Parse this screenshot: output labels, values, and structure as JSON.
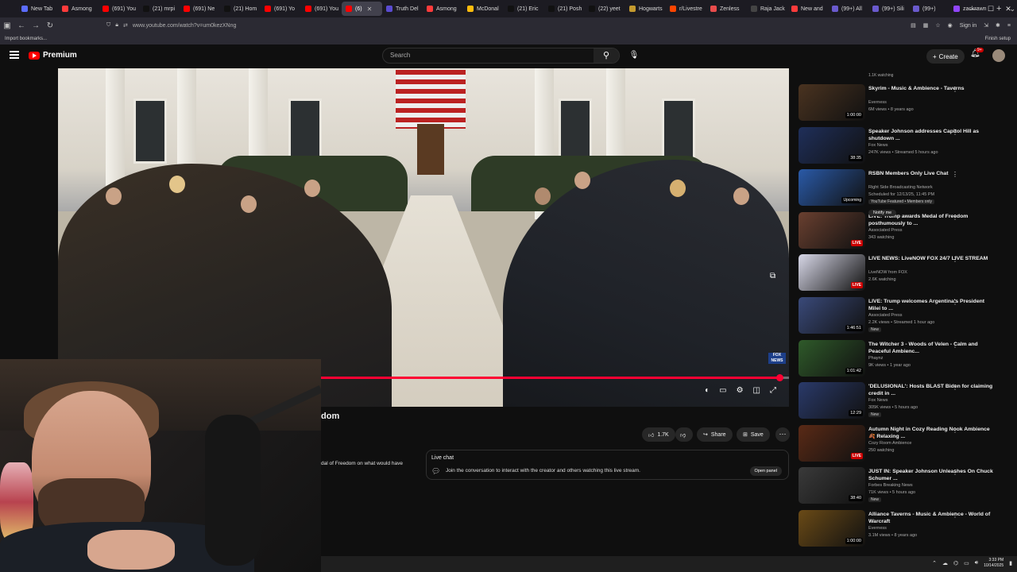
{
  "browser": {
    "tabs": [
      {
        "label": "New Tab",
        "color": "#5b6cff"
      },
      {
        "label": "Asmong",
        "color": "#ff3b3b"
      },
      {
        "label": "(691) You",
        "color": "#ff0000"
      },
      {
        "label": "(21) mrpi",
        "color": "#111111"
      },
      {
        "label": "(691) Ne",
        "color": "#ff0000"
      },
      {
        "label": "(21) Hom",
        "color": "#111111"
      },
      {
        "label": "(691) Yo",
        "color": "#ff0000"
      },
      {
        "label": "(691) You",
        "color": "#ff0000"
      },
      {
        "label": "(6)",
        "color": "#ff0000",
        "active": true
      },
      {
        "label": "Truth Del",
        "color": "#5a4bd1"
      },
      {
        "label": "Asmong",
        "color": "#ff3b3b"
      },
      {
        "label": "McDonal",
        "color": "#ffbc0d"
      },
      {
        "label": "(21) Eric",
        "color": "#111111"
      },
      {
        "label": "(21) Posh",
        "color": "#111111"
      },
      {
        "label": "(22) yeet",
        "color": "#111111"
      },
      {
        "label": "Hogwarts",
        "color": "#c49a2e"
      },
      {
        "label": "r/Livestre",
        "color": "#ff4500"
      },
      {
        "label": "Zenless",
        "color": "#e94c4c"
      },
      {
        "label": "Raja Jack",
        "color": "#444444"
      },
      {
        "label": "New and",
        "color": "#ff3b3b"
      },
      {
        "label": "(99+) All",
        "color": "#6a5acd"
      },
      {
        "label": "(99+) Sili",
        "color": "#6a5acd"
      },
      {
        "label": "(99+)",
        "color": "#6a5acd"
      },
      {
        "label": "zackrawn",
        "color": "#9146ff"
      }
    ],
    "url": "www.youtube.com/watch?v=um0kezXNng",
    "sign_in": "Sign in",
    "bookmarks_left": "Import bookmarks...",
    "bookmarks_right": "Finish setup"
  },
  "youtube": {
    "logo_label": "Premium",
    "search_placeholder": "Search",
    "create_label": "Create",
    "notification_count": "9+"
  },
  "video": {
    "title_partial": "dom",
    "progress_fraction": 0.98,
    "network_bug": "FOX NEWS",
    "likes": "1.7K",
    "share_label": "Share",
    "save_label": "Save",
    "description_partial": "dal of Freedom on what would have"
  },
  "live_chat": {
    "title": "Live chat",
    "message": "Join the conversation to interact with the creator and others watching this live stream.",
    "open_label": "Open panel"
  },
  "sidebar": {
    "top_partial_meta": "1.1K watching",
    "notify_label": "Notify me",
    "items": [
      {
        "title": "Skyrim - Music & Ambience - Taverns",
        "channel": "Everness",
        "meta": "6M views • 8 years ago",
        "duration": "1:00:00",
        "badge": "",
        "thumb": "#4a3320"
      },
      {
        "title": "Speaker Johnson addresses Capitol Hill as shutdown ...",
        "channel": "Fox News",
        "meta": "247K views • Streamed 5 hours ago",
        "duration": "38:35",
        "badge": "",
        "thumb": "#1f2f5a"
      },
      {
        "title": "RSBN Members Only Live Chat",
        "channel": "Right Side Broadcasting Network",
        "meta": "Scheduled for 12/13/25, 11:45 PM",
        "duration": "Upcoming",
        "badge": "YouTube Featured • Members only",
        "thumb": "#2a5aa8"
      },
      {
        "title": "LIVE: Trump awards Medal of Freedom posthumously to ...",
        "channel": "Associated Press",
        "meta": "343 watching",
        "duration": "LIVE",
        "badge": "",
        "thumb": "#6a4030"
      },
      {
        "title": "LIVE NEWS: LiveNOW FOX 24/7 LIVE STREAM",
        "channel": "LiveNOW from FOX",
        "meta": "2.6K watching",
        "duration": "LIVE",
        "badge": "",
        "thumb": "#d8d8e8"
      },
      {
        "title": "LIVE: Trump welcomes Argentina's President Milei to ...",
        "channel": "Associated Press",
        "meta": "2.2K views • Streamed 1 hour ago",
        "duration": "1:46:51",
        "badge": "New",
        "thumb": "#3a4a7a"
      },
      {
        "title": "The Witcher 3 - Woods of Velen - Calm and Peaceful Ambienc...",
        "channel": "Phaynz",
        "meta": "9K views • 1 year ago",
        "duration": "1:01:42",
        "badge": "",
        "thumb": "#2f5a2a"
      },
      {
        "title": "'DELUSIONAL': Hosts BLAST Biden for claiming credit in ...",
        "channel": "Fox News",
        "meta": "305K views • 5 hours ago",
        "duration": "12:29",
        "badge": "New",
        "thumb": "#2a3a6a"
      },
      {
        "title": "Autumn Night in Cozy Reading Nook Ambience 🍂 Relaxing ...",
        "channel": "Cozy Room Ambience",
        "meta": "250 watching",
        "duration": "LIVE",
        "badge": "",
        "thumb": "#5a2a16"
      },
      {
        "title": "JUST IN: Speaker Johnson Unleashes On Chuck Schumer ...",
        "channel": "Forbes Breaking News",
        "meta": "71K views • 5 hours ago",
        "duration": "38:40",
        "badge": "New",
        "thumb": "#3a3a3a"
      },
      {
        "title": "Alliance Taverns - Music & Ambience - World of Warcraft",
        "channel": "Everness",
        "meta": "3.1M views • 8 years ago",
        "duration": "1:00:00",
        "badge": "",
        "thumb": "#6a4a16"
      }
    ]
  },
  "taskbar": {
    "time": "3:33 PM",
    "date": "10/14/2025"
  }
}
